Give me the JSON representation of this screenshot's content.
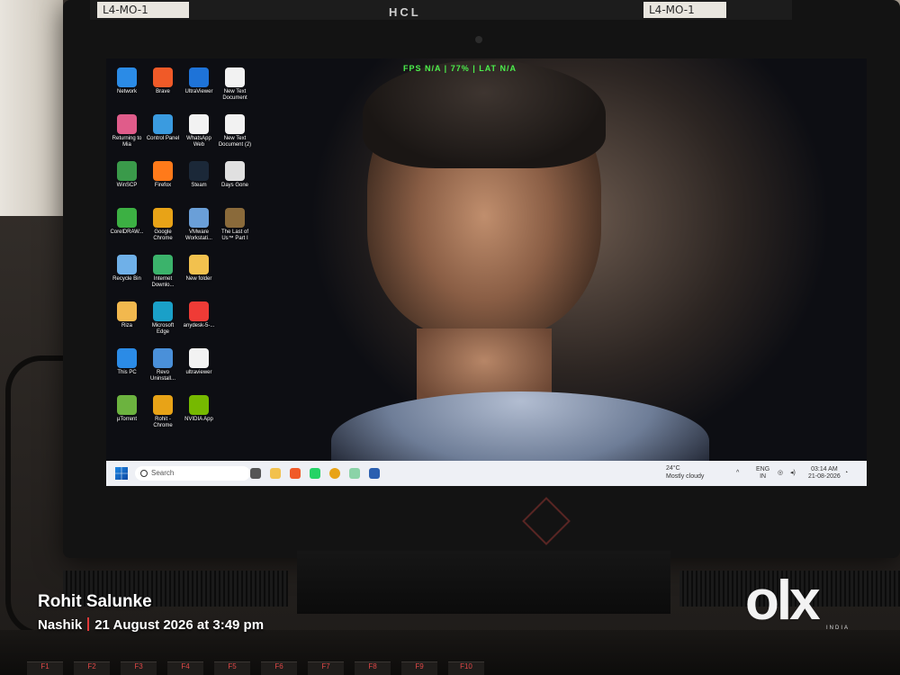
{
  "monitor": {
    "brand": "HCL",
    "sticker_left": "L4-MO-1",
    "sticker_right": "L4-MO-1",
    "overlay": "FPS N/A  |  77%  |  LAT N/A"
  },
  "desktop_icons": [
    {
      "label": "Network",
      "color": "#2b8be6"
    },
    {
      "label": "Brave",
      "color": "#f05a28"
    },
    {
      "label": "UltraViewer",
      "color": "#1e73d8"
    },
    {
      "label": "New Text Document",
      "color": "#f2f2f2"
    },
    {
      "label": "Returning to Mia",
      "color": "#e05c8a"
    },
    {
      "label": "Control Panel",
      "color": "#3a9be0"
    },
    {
      "label": "WhatsApp Web",
      "color": "#f2f2f2"
    },
    {
      "label": "New Text Document (2)",
      "color": "#f2f2f2"
    },
    {
      "label": "WinSCP",
      "color": "#3a9a4a"
    },
    {
      "label": "Firefox",
      "color": "#ff7a1a"
    },
    {
      "label": "Steam",
      "color": "#1b2838"
    },
    {
      "label": "Days Gone",
      "color": "#e0e0e0"
    },
    {
      "label": "CorelDRAW...",
      "color": "#3cb043"
    },
    {
      "label": "Google Chrome",
      "color": "#e8a317"
    },
    {
      "label": "VMware Workstati...",
      "color": "#6a9fd8"
    },
    {
      "label": "The Last of Us™ Part I",
      "color": "#8a6a3a"
    },
    {
      "label": "Recycle Bin",
      "color": "#6fb0e8"
    },
    {
      "label": "Internet Downlo...",
      "color": "#3bb36b"
    },
    {
      "label": "New folder",
      "color": "#f2c14e"
    },
    {
      "label": "",
      "color": "#0d0e13"
    },
    {
      "label": "Riza",
      "color": "#f2b84e"
    },
    {
      "label": "Microsoft Edge",
      "color": "#1aa0c8"
    },
    {
      "label": "anydesk-5-...",
      "color": "#ef3b36"
    },
    {
      "label": "",
      "color": "#0d0e13"
    },
    {
      "label": "This PC",
      "color": "#2b8be6"
    },
    {
      "label": "Revo Uninstall...",
      "color": "#4a90d9"
    },
    {
      "label": "ultraviewer",
      "color": "#f2f2f2"
    },
    {
      "label": "",
      "color": "#0d0e13"
    },
    {
      "label": "µTorrent",
      "color": "#6cb33f"
    },
    {
      "label": "Rohit - Chrome",
      "color": "#e8a317"
    },
    {
      "label": "NVIDIA App",
      "color": "#76b900"
    },
    {
      "label": "",
      "color": "#0d0e13"
    }
  ],
  "taskbar": {
    "search_placeholder": "Search",
    "weather_temp": "24°C",
    "weather_desc": "Mostly cloudy",
    "lang": "ENG",
    "region": "IN",
    "time": "03:14 AM",
    "date": "21-08-2026"
  },
  "caption": {
    "name": "Rohit Salunke",
    "location": "Nashik",
    "datetime": "21 August 2026 at 3:49 pm"
  },
  "watermark": {
    "logo": "olx",
    "sub": "INDIA"
  },
  "keyboard": {
    "keys": [
      "F1",
      "F2",
      "F3",
      "F4",
      "F5",
      "F6",
      "F7",
      "F8",
      "F9",
      "F10"
    ]
  }
}
